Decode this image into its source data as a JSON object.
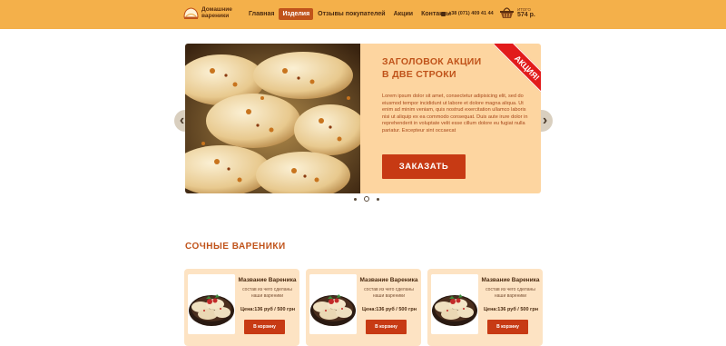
{
  "header": {
    "logo_line1": "Домашние",
    "logo_line2": "вареники",
    "nav": [
      "Главная",
      "Изделия",
      "Отзывы покупателей",
      "Акции",
      "Контакты"
    ],
    "active_nav_index": 1,
    "phone": "+38 (071) 409 41 44",
    "cart_label": "ИТОГО",
    "cart_total": "574 р."
  },
  "slider": {
    "title": "ЗАГОЛОВОК АКЦИИ В ДВЕ СТРОКИ",
    "text": "Lorem ipsum dolor sit amet, consectetur adipisicing elit, sed do eiusmod tempor incididunt ut labore et dolore magna aliqua. Ut enim ad minim veniam, quis nostrud exercitation ullamco laboris nisi ut aliquip ex ea commodo consequat. Duis aute irure dolor in reprehenderit in voluptate velit esse cillum dolore eu fugiat nulla pariatur. Excepteur sint occaecat",
    "button": "ЗАКАЗАТЬ",
    "ribbon": "АКЦИЯ!",
    "prev_icon": "‹",
    "next_icon": "›",
    "dots_count": 3,
    "active_dot": 1
  },
  "section": {
    "title": "СОЧНЫЕ ВАРЕНИКИ"
  },
  "products": [
    {
      "name": "Мазвание Вареника",
      "desc": "состав из чего сделаны наши вареники",
      "price": "Цена:136 руб / 500 грн",
      "button": "В корзину"
    },
    {
      "name": "Мазвание Вареника",
      "desc": "состав из чего сделаны наши вареники",
      "price": "Цена:136 руб / 500 грн",
      "button": "В корзину"
    },
    {
      "name": "Мазвание Вареника",
      "desc": "состав из чего сделаны наши вареники",
      "price": "Цена:136 руб / 500 грн",
      "button": "В корзину"
    }
  ],
  "colors": {
    "header_bg": "#f4b04a",
    "accent": "#c0531a",
    "button": "#c73a14",
    "panel": "#fdd5a0",
    "card": "#fde3c3",
    "ribbon": "#e21b1b"
  }
}
